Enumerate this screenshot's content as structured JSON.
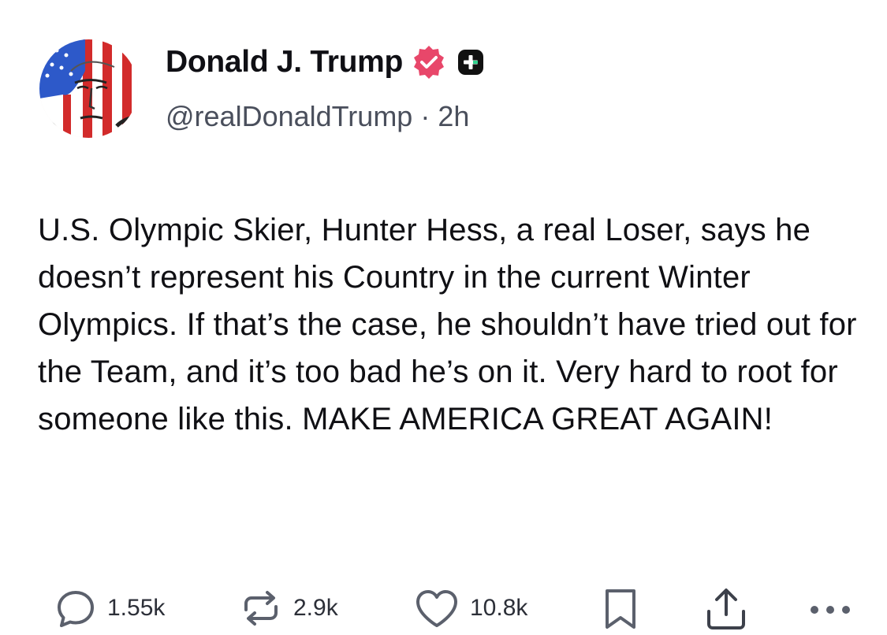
{
  "post": {
    "author": {
      "display_name": "Donald J. Trump",
      "handle": "@realDonaldTrump",
      "verified": true,
      "verified_color": "#e8476a",
      "plus_badge_color": "#111111"
    },
    "separator": "·",
    "time_ago": "2h",
    "body": "U.S. Olympic Skier, Hunter Hess, a real Loser, says he doesn’t represent his Country in the current Winter Olympics. If that’s the case, he shouldn’t have tried out for the Team, and it’s too bad he’s on it. Very hard to root for someone like this. MAKE AMERICA GREAT AGAIN!",
    "actions": {
      "replies": {
        "icon": "reply-bubble-icon",
        "count": "1.55k"
      },
      "reposts": {
        "icon": "repost-icon",
        "count": "2.9k"
      },
      "likes": {
        "icon": "heart-icon",
        "count": "10.8k"
      },
      "bookmark": {
        "icon": "bookmark-icon"
      },
      "share": {
        "icon": "share-upload-icon"
      },
      "more": {
        "icon": "more-dots-icon"
      }
    }
  }
}
